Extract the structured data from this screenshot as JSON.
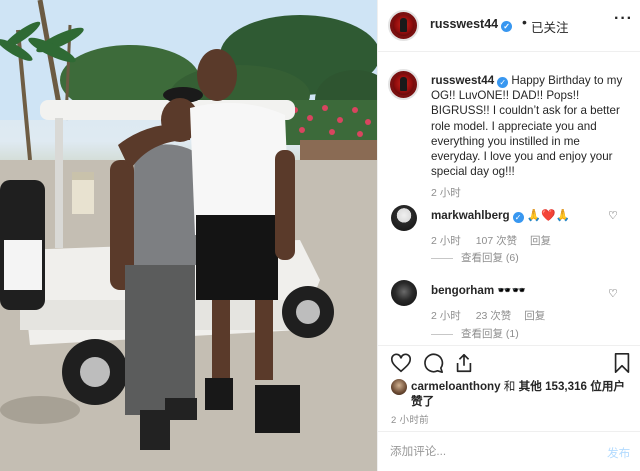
{
  "header": {
    "username": "russwest44",
    "separator": "•",
    "follow_status": "已关注",
    "more_label": "···"
  },
  "caption": {
    "username": "russwest44",
    "text": "Happy Birthday to my OG!! LuvONE!! DAD!! Pops!! BIGRUSS!! I couldn’t ask for a better role model. I appreciate you and everything you instilled in me everyday. I love you and enjoy your special day og!!!",
    "time": "2 小时"
  },
  "comments": [
    {
      "username": "markwahlberg",
      "text": "🙏❤️🙏",
      "time": "2 小时",
      "likes": "107 次赞",
      "reply_label": "回复",
      "view_replies": "查看回复 (6)"
    },
    {
      "username": "bengorham",
      "text": "🕶️🕶️",
      "time": "2 小时",
      "likes": "23 次赞",
      "reply_label": "回复",
      "view_replies": "查看回复 (1)"
    }
  ],
  "actions": {
    "like_icon": "heart-outline",
    "comment_icon": "speech-bubble",
    "share_icon": "share-arrow",
    "save_icon": "bookmark"
  },
  "likes": {
    "user": "carmeloanthony",
    "connector": "和",
    "others_label": "其他",
    "count": "153,316",
    "suffix": "位用户赞了"
  },
  "posted_time": "2 小时前",
  "add_comment": {
    "placeholder": "添加评论...",
    "post_label": "发布"
  },
  "colors": {
    "verified_blue": "#3897f0",
    "post_disabled": "#b3dbff",
    "meta_gray": "#8e8e8e"
  }
}
